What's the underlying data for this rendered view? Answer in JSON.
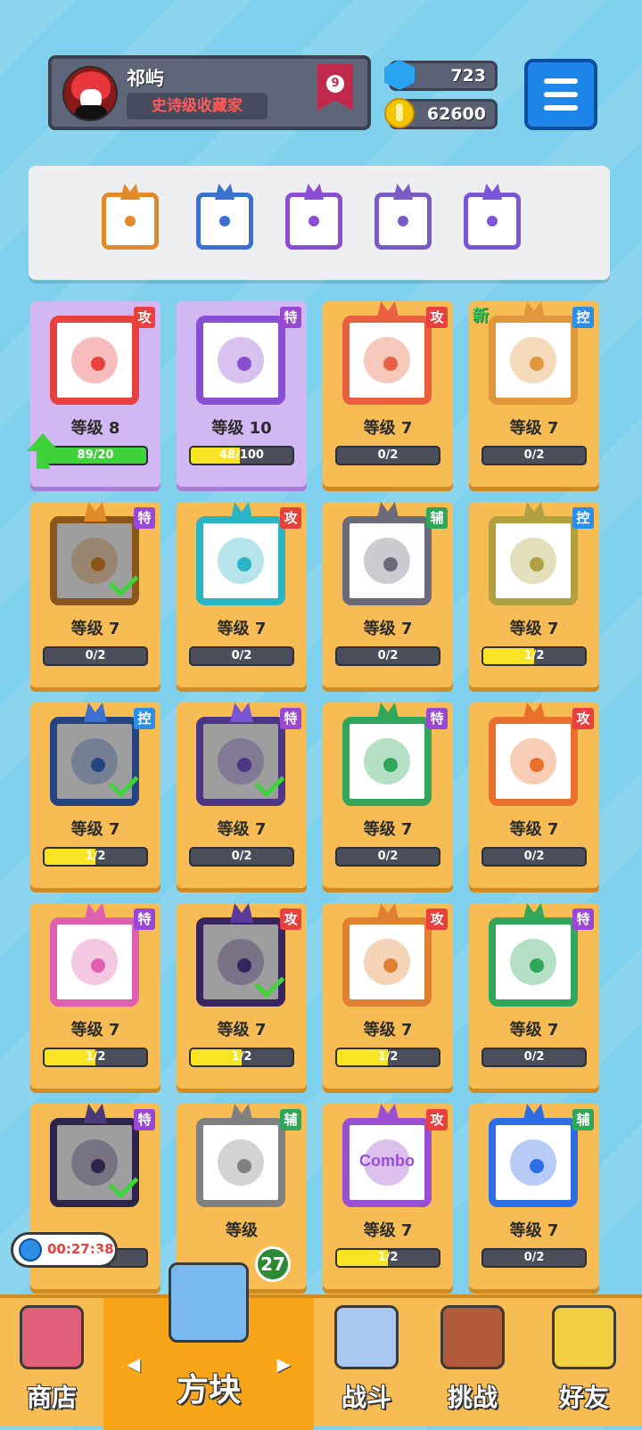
{
  "profile": {
    "name": "祁屿",
    "title": "史诗级收藏家",
    "rank": "9"
  },
  "currency": {
    "gems": "723",
    "gold": "62600"
  },
  "deck": [
    {
      "icon": "infinity-icon",
      "color": "#e08a2a"
    },
    {
      "icon": "snowflake-icon",
      "color": "#3b6fd0"
    },
    {
      "icon": "atom-icon",
      "color": "#8a4ed2"
    },
    {
      "icon": "orb-icon",
      "color": "#7a5bc4"
    },
    {
      "icon": "swirl-icon",
      "color": "#7a55d6"
    }
  ],
  "cards": [
    {
      "tag": "攻",
      "tag_type": "atk",
      "level": "等级 8",
      "progress": "89/20",
      "fill": 1.0,
      "color": "#e8403f",
      "bg": "purple",
      "icon": "fire-icon",
      "dim": false,
      "check": false,
      "upgrade": true
    },
    {
      "tag": "特",
      "tag_type": "spc",
      "level": "等级 10",
      "progress": "48/100",
      "fill": 0.48,
      "color": "#8a4ed2",
      "bg": "purple",
      "icon": "crack-icon",
      "dim": false,
      "check": false
    },
    {
      "tag": "攻",
      "tag_type": "atk",
      "level": "等级 7",
      "progress": "0/2",
      "fill": 0,
      "color": "#e8603f",
      "icon": "star-burst-icon",
      "dim": false,
      "check": false
    },
    {
      "tag": "控",
      "tag_type": "ctl",
      "level": "等级 7",
      "progress": "0/2",
      "fill": 0,
      "color": "#e0963a",
      "icon": "sand-icon",
      "dim": false,
      "check": false,
      "new": "新"
    },
    {
      "tag": "特",
      "tag_type": "spc",
      "level": "等级 7",
      "progress": "0/2",
      "fill": 0,
      "color": "#e08a2a",
      "icon": "infinity-icon",
      "dim": true,
      "check": true
    },
    {
      "tag": "攻",
      "tag_type": "atk",
      "level": "等级 7",
      "progress": "0/2",
      "fill": 0,
      "color": "#2ab5c4",
      "icon": "ice-spirit-icon",
      "dim": false,
      "check": false
    },
    {
      "tag": "辅",
      "tag_type": "sup",
      "level": "等级 7",
      "progress": "0/2",
      "fill": 0,
      "color": "#6a6a7a",
      "icon": "jaw-icon",
      "dim": false,
      "check": false
    },
    {
      "tag": "控",
      "tag_type": "ctl",
      "level": "等级 7",
      "progress": "1/2",
      "fill": 0.5,
      "color": "#b0a040",
      "icon": "shield-icon",
      "dim": false,
      "check": false
    },
    {
      "tag": "控",
      "tag_type": "ctl",
      "level": "等级 7",
      "progress": "1/2",
      "fill": 0.5,
      "color": "#3b6fd0",
      "icon": "snowflake-icon",
      "dim": true,
      "check": true
    },
    {
      "tag": "特",
      "tag_type": "spc",
      "level": "等级 7",
      "progress": "0/2",
      "fill": 0,
      "color": "#7a55d6",
      "icon": "swirl-icon",
      "dim": true,
      "check": true
    },
    {
      "tag": "特",
      "tag_type": "spc",
      "level": "等级 7",
      "progress": "0/2",
      "fill": 0,
      "color": "#2fa65a",
      "icon": "pentagram-icon",
      "dim": false,
      "check": false
    },
    {
      "tag": "攻",
      "tag_type": "atk",
      "level": "等级 7",
      "progress": "0/2",
      "fill": 0,
      "color": "#e8702a",
      "icon": "sun-icon",
      "dim": false,
      "check": false
    },
    {
      "tag": "特",
      "tag_type": "spc",
      "level": "等级 7",
      "progress": "1/2",
      "fill": 0.5,
      "color": "#e060b0",
      "icon": "syringe-icon",
      "dim": false,
      "check": false
    },
    {
      "tag": "攻",
      "tag_type": "atk",
      "level": "等级 7",
      "progress": "1/2",
      "fill": 0.5,
      "color": "#5a3a9a",
      "icon": "atom-icon",
      "dim": true,
      "check": true
    },
    {
      "tag": "攻",
      "tag_type": "atk",
      "level": "等级 7",
      "progress": "1/2",
      "fill": 0.5,
      "color": "#e08030",
      "icon": "gun-icon",
      "dim": false,
      "check": false
    },
    {
      "tag": "特",
      "tag_type": "spc",
      "level": "等级 7",
      "progress": "0/2",
      "fill": 0,
      "color": "#2fa65a",
      "icon": "poison-icon",
      "dim": false,
      "check": false
    },
    {
      "tag": "特",
      "tag_type": "spc",
      "level": "",
      "progress": "0/2",
      "fill": 0,
      "color": "#4a3a7a",
      "icon": "dark-orb-icon",
      "dim": true,
      "check": true
    },
    {
      "tag": "辅",
      "tag_type": "sup",
      "level": "等级",
      "progress": "",
      "fill": 0,
      "color": "#808080",
      "icon": "cycle-icon",
      "dim": false,
      "check": false
    },
    {
      "tag": "攻",
      "tag_type": "atk",
      "level": "等级 7",
      "progress": "1/2",
      "fill": 0.5,
      "color": "#9a4ed2",
      "icon": "combo-icon",
      "dim": false,
      "check": false,
      "art_text": "Combo"
    },
    {
      "tag": "辅",
      "tag_type": "sup",
      "level": "等级 7",
      "progress": "0/2",
      "fill": 0,
      "color": "#2d6ee6",
      "icon": "moon-icon",
      "dim": false,
      "check": false
    }
  ],
  "timer": "00:27:38",
  "unopened_boxes": "27",
  "nav": [
    {
      "label": "商店",
      "icon": "shop-icon",
      "color": "#e0607a"
    },
    {
      "label": "方块",
      "icon": "mystery-box-icon",
      "color": "#7ab8f0",
      "active": true
    },
    {
      "label": "战斗",
      "icon": "battle-icon",
      "color": "#a8c8f0"
    },
    {
      "label": "挑战",
      "icon": "challenge-icon",
      "color": "#b05a3a"
    },
    {
      "label": "好友",
      "icon": "friends-icon",
      "color": "#f0d040"
    }
  ]
}
